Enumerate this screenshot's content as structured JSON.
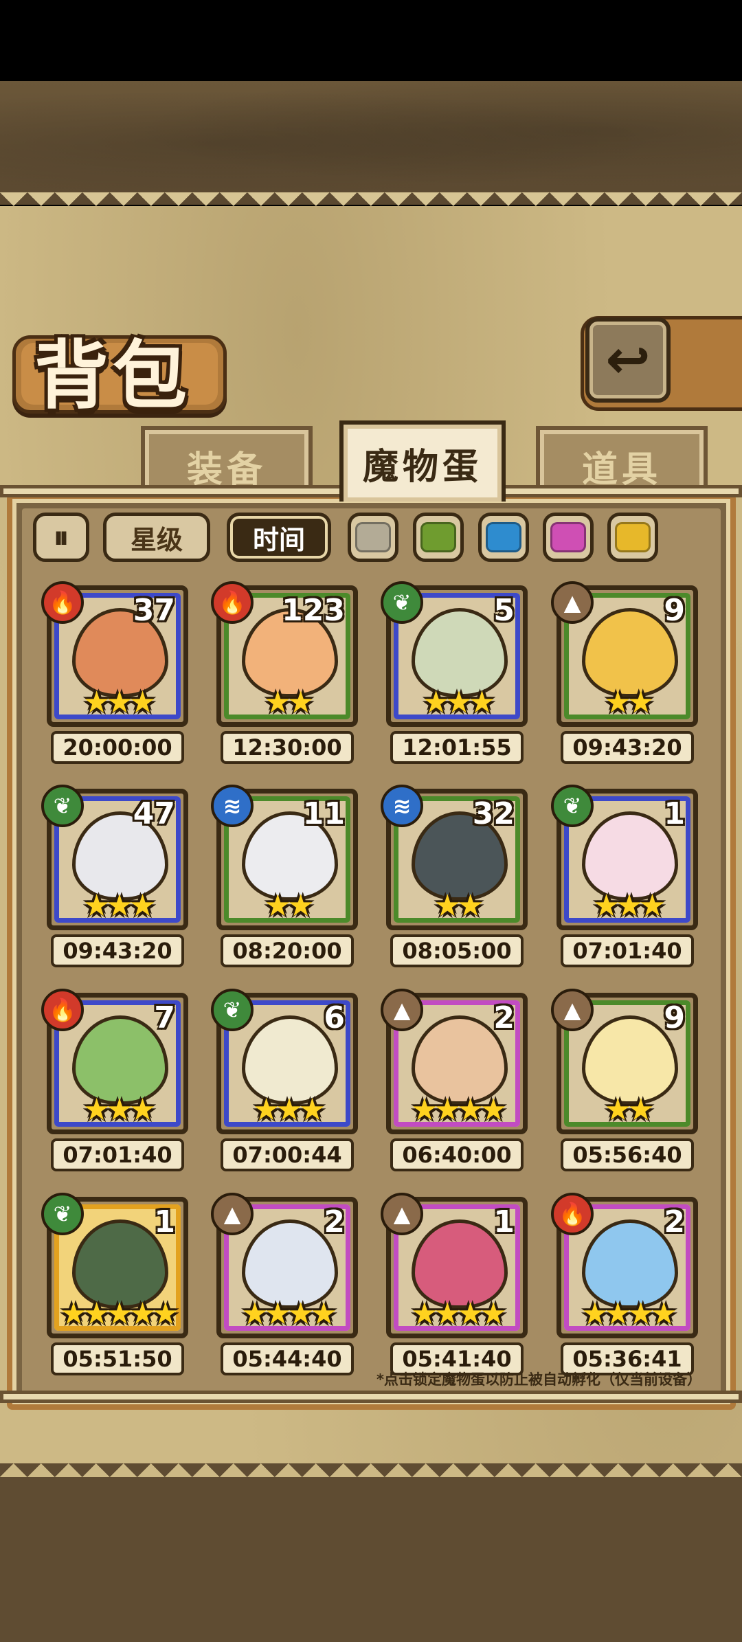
{
  "title": "背包",
  "tabs": [
    {
      "label": "装备",
      "active": false
    },
    {
      "label": "魔物蛋",
      "active": true
    },
    {
      "label": "道具",
      "active": false
    }
  ],
  "filters": {
    "toggle_icon": "sort-toggle-icon",
    "star_label": "星级",
    "time_label": "时间",
    "swatches": [
      "#b3ab96",
      "#6f9c2f",
      "#2e8ccf",
      "#cf4fb4",
      "#e7b82a"
    ]
  },
  "elements": {
    "fire": {
      "glyph": "🔥",
      "color": "#d23a2a"
    },
    "nature": {
      "glyph": "❦",
      "color": "#3f8a3b"
    },
    "water": {
      "glyph": "≋",
      "color": "#2f6fc8"
    },
    "earth": {
      "glyph": "▲",
      "color": "#8a6a4a"
    }
  },
  "eggs": [
    {
      "count": "37",
      "element": "fire",
      "rarity": "blue",
      "stars": "★★★",
      "time": "20:00:00",
      "egg_color": "#e08a5a"
    },
    {
      "count": "123",
      "element": "fire",
      "rarity": "green",
      "stars": "★★",
      "time": "12:30:00",
      "egg_color": "#f2b27a"
    },
    {
      "count": "5",
      "element": "nature",
      "rarity": "blue",
      "stars": "★★★",
      "time": "12:01:55",
      "egg_color": "#cfd9b8"
    },
    {
      "count": "9",
      "element": "earth",
      "rarity": "green",
      "stars": "★★",
      "time": "09:43:20",
      "egg_color": "#f1c24a"
    },
    {
      "count": "47",
      "element": "nature",
      "rarity": "blue",
      "stars": "★★★",
      "time": "09:43:20",
      "egg_color": "#e8e8ec"
    },
    {
      "count": "11",
      "element": "water",
      "rarity": "green",
      "stars": "★★",
      "time": "08:20:00",
      "egg_color": "#ececef"
    },
    {
      "count": "32",
      "element": "water",
      "rarity": "green",
      "stars": "★★",
      "time": "08:05:00",
      "egg_color": "#4b5558"
    },
    {
      "count": "1",
      "element": "nature",
      "rarity": "blue",
      "stars": "★★★",
      "time": "07:01:40",
      "egg_color": "#f6dbe4"
    },
    {
      "count": "7",
      "element": "fire",
      "rarity": "blue",
      "stars": "★★★",
      "time": "07:01:40",
      "egg_color": "#8cc069"
    },
    {
      "count": "6",
      "element": "nature",
      "rarity": "blue",
      "stars": "★★★",
      "time": "07:00:44",
      "egg_color": "#f0ead0"
    },
    {
      "count": "2",
      "element": "earth",
      "rarity": "purple",
      "stars": "★★★★",
      "time": "06:40:00",
      "egg_color": "#e9c39e"
    },
    {
      "count": "9",
      "element": "earth",
      "rarity": "green",
      "stars": "★★",
      "time": "05:56:40",
      "egg_color": "#f7e7a8"
    },
    {
      "count": "1",
      "element": "nature",
      "rarity": "gold",
      "stars": "★★★★★",
      "time": "05:51:50",
      "egg_color": "#4e6a47"
    },
    {
      "count": "2",
      "element": "earth",
      "rarity": "purple",
      "stars": "★★★★",
      "time": "05:44:40",
      "egg_color": "#dfe5ef"
    },
    {
      "count": "1",
      "element": "earth",
      "rarity": "purple",
      "stars": "★★★★",
      "time": "05:41:40",
      "egg_color": "#d75c7c"
    },
    {
      "count": "2",
      "element": "fire",
      "rarity": "purple",
      "stars": "★★★★",
      "time": "05:36:41",
      "egg_color": "#8fc7ee"
    }
  ],
  "note": "*点击锁定魔物蛋以防止被自动孵化（仅当前设备）"
}
